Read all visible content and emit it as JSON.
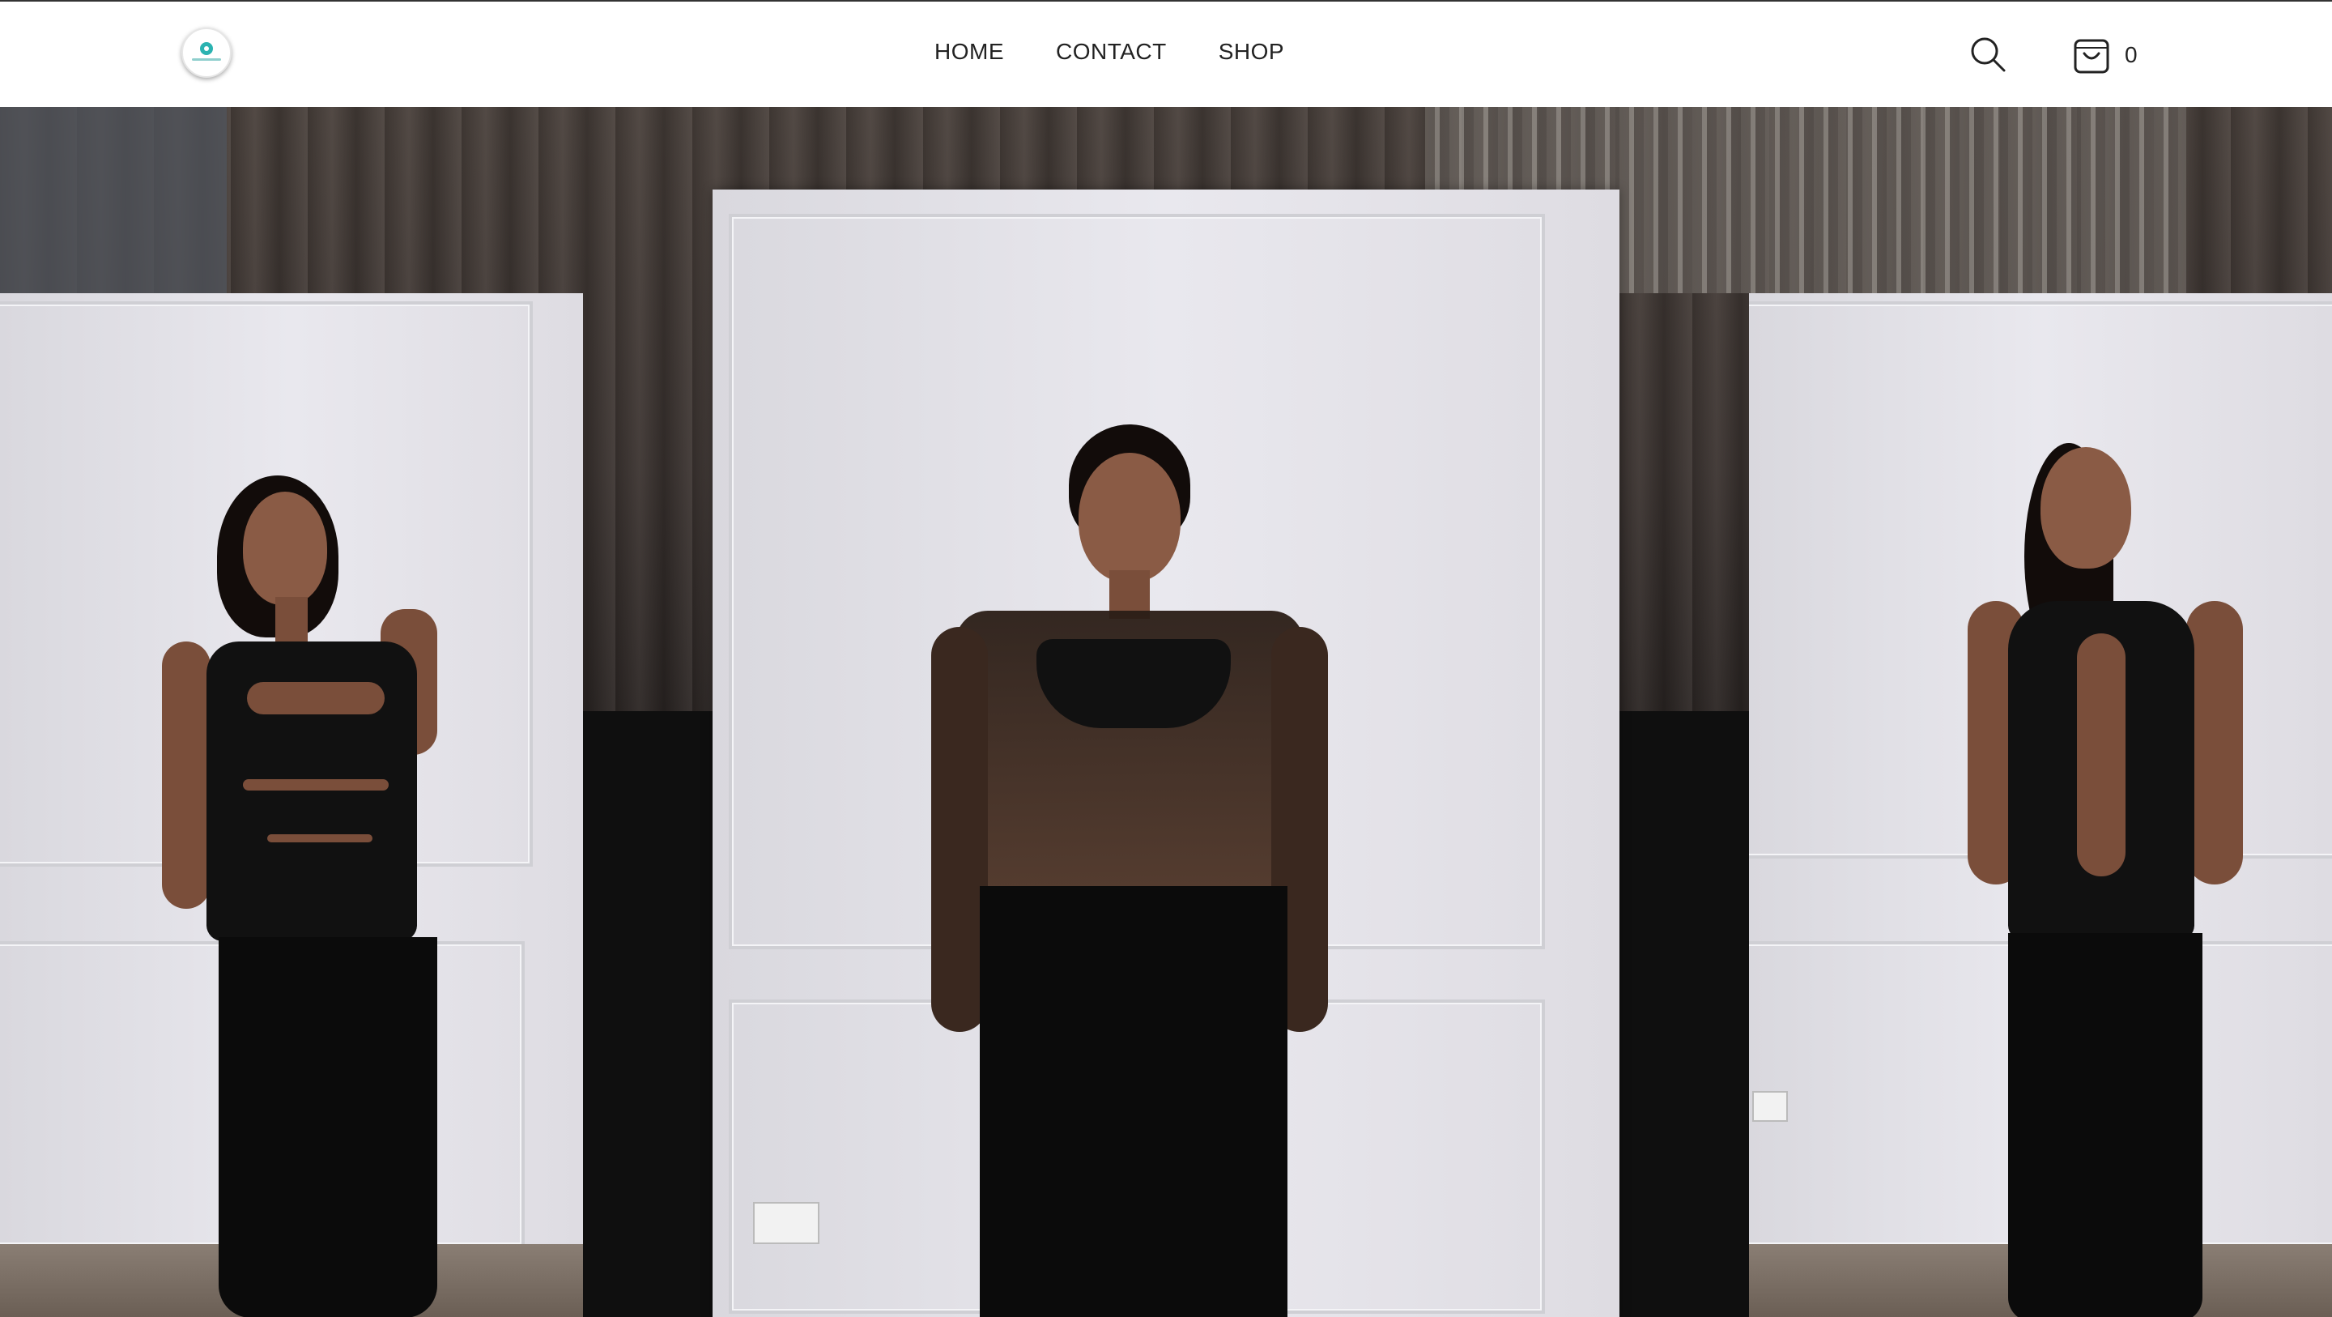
{
  "header": {
    "logo_name": "brand-logo",
    "nav": [
      {
        "label": "HOME"
      },
      {
        "label": "CONTACT"
      },
      {
        "label": "SHOP"
      }
    ],
    "search_icon": "search-icon",
    "cart_icon": "shopping-bag-icon",
    "cart_count": "0"
  },
  "hero": {
    "slides": [
      {
        "name": "model-black-cutout-top-maxi-skirt"
      },
      {
        "name": "model-sheer-lace-top-black-jeans"
      },
      {
        "name": "model-black-cutout-maxi-dress"
      }
    ]
  },
  "colors": {
    "header_bg": "#ffffff",
    "nav_text": "#222222",
    "logo_accent": "#2bb3b1",
    "hero_dark": "#0f0f0f"
  }
}
